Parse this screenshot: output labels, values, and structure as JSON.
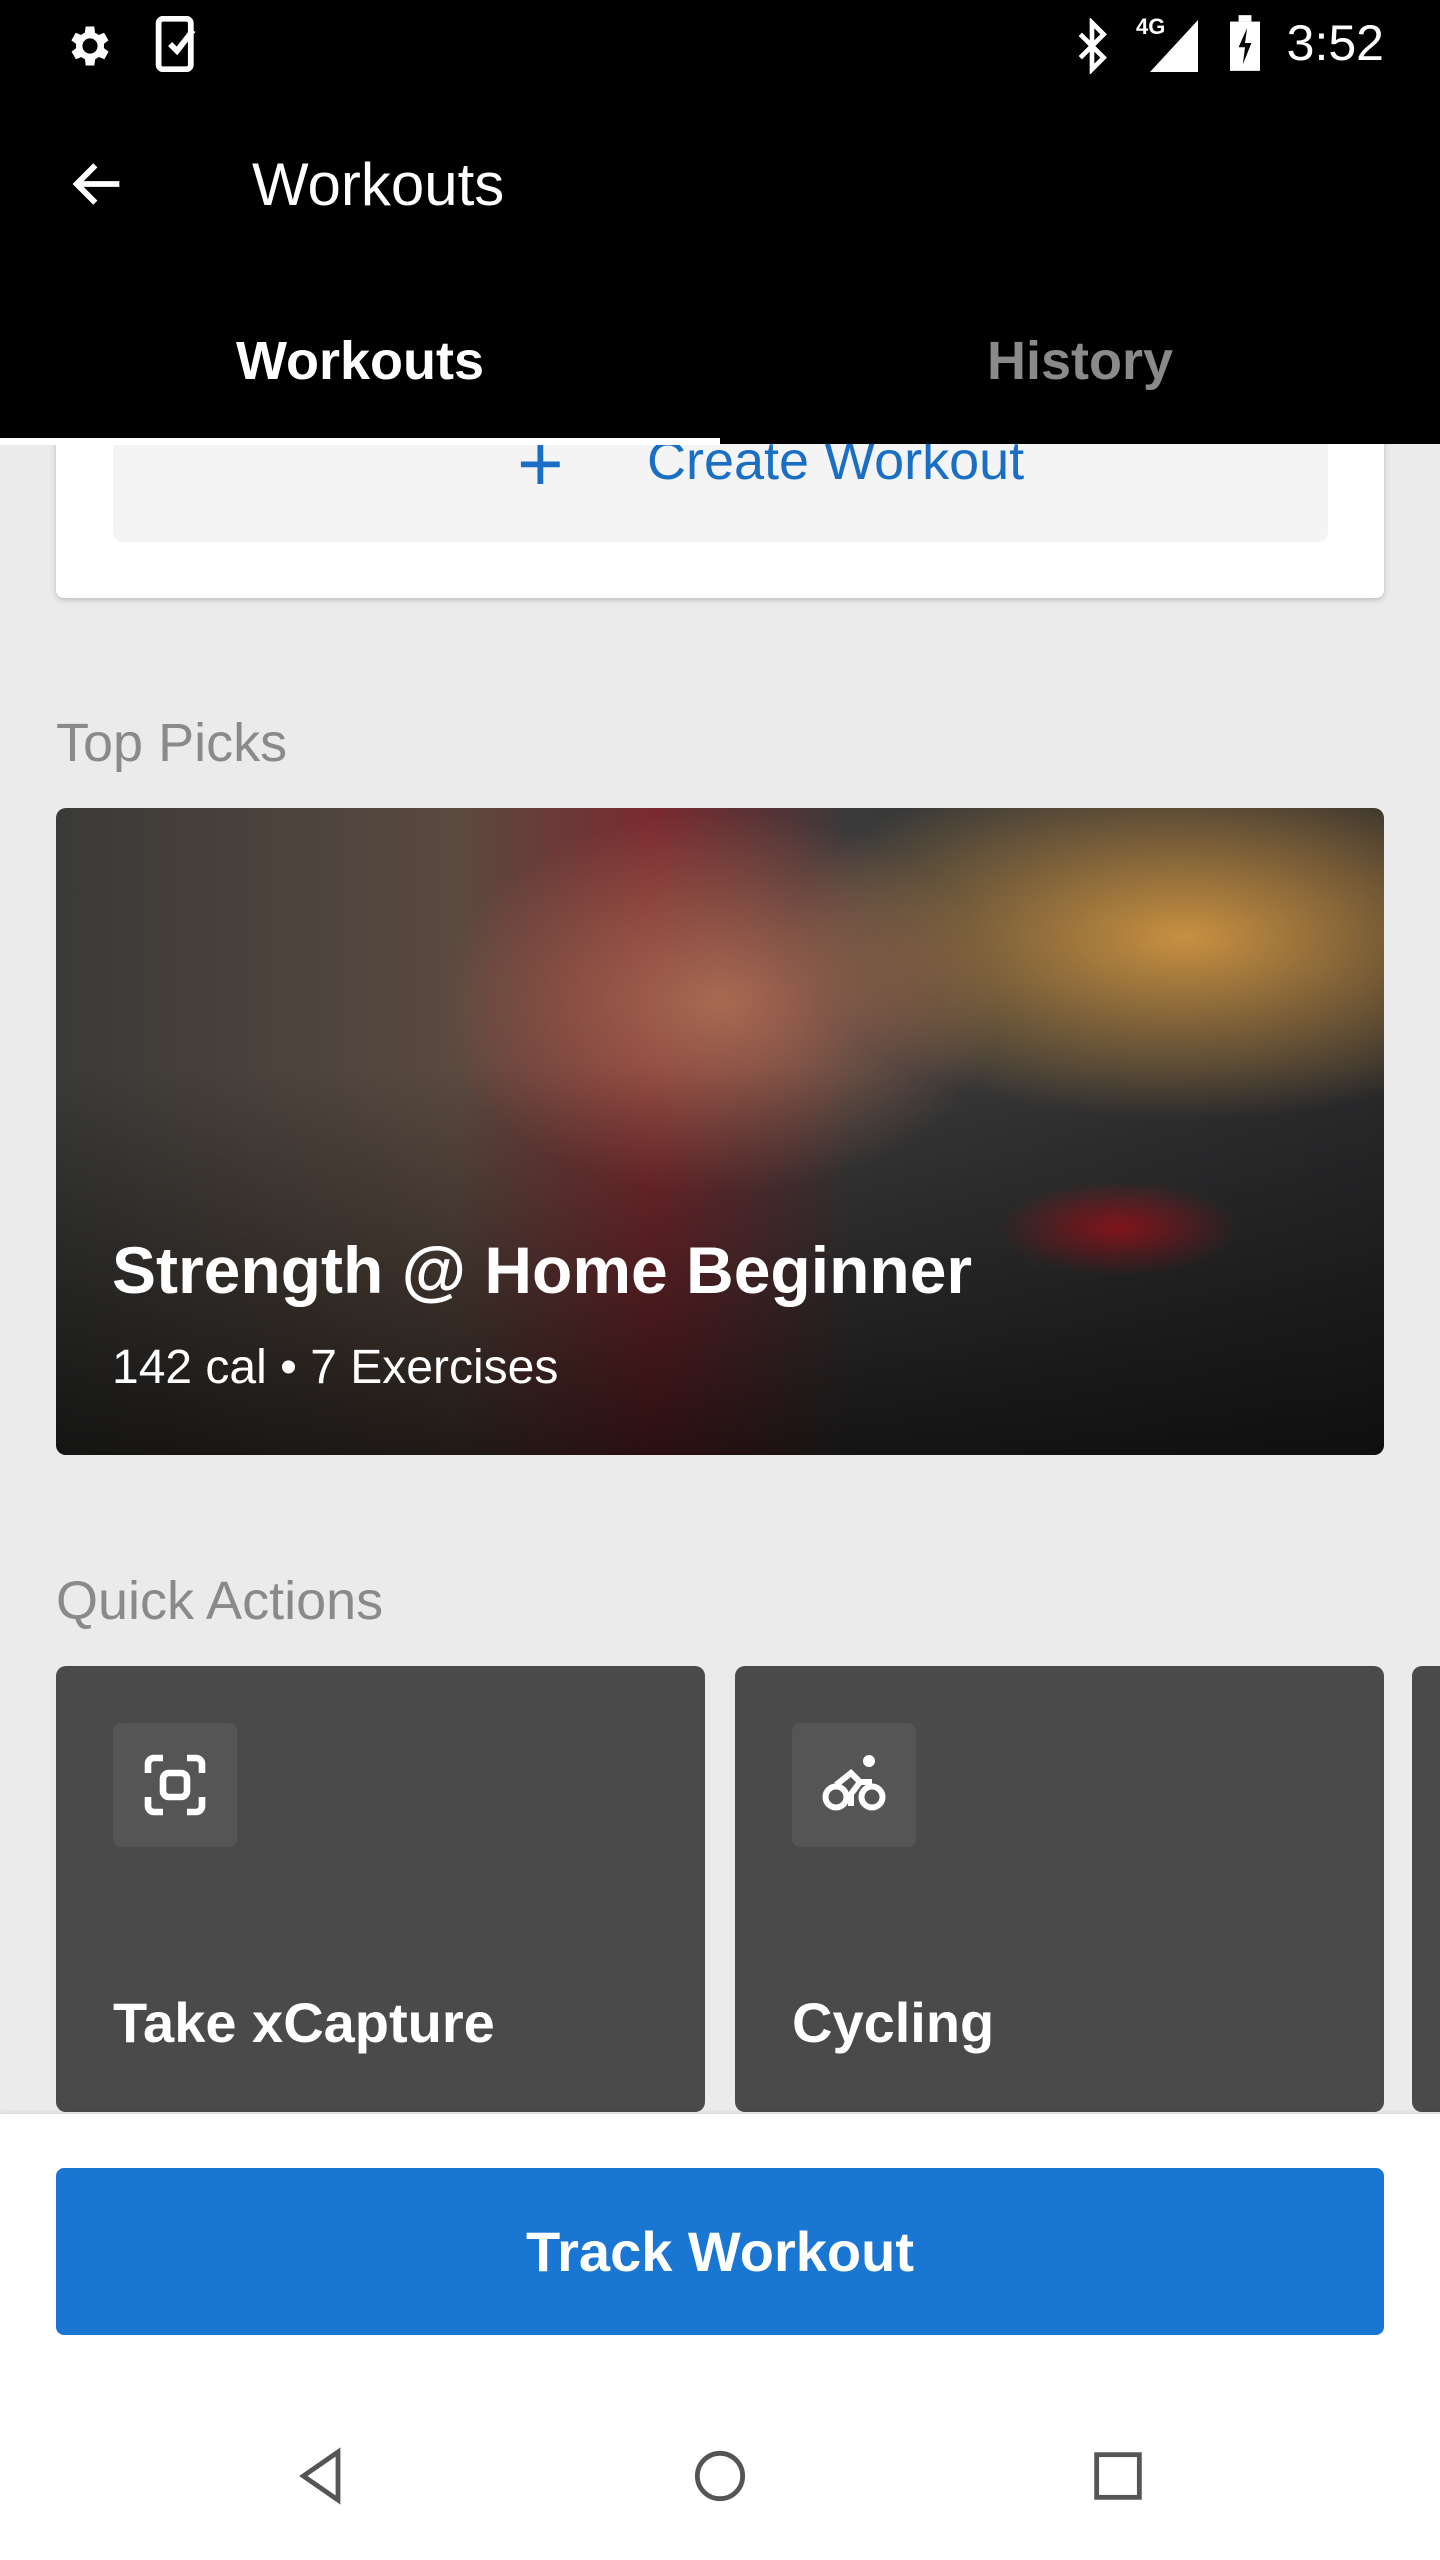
{
  "status_bar": {
    "time": "3:52",
    "network": "4G",
    "icons": [
      "settings-icon",
      "device-check-icon",
      "bluetooth-icon",
      "signal-icon",
      "battery-charging-icon"
    ]
  },
  "app_bar": {
    "title": "Workouts",
    "back_icon": "arrow-left-icon"
  },
  "tabs": [
    {
      "label": "Workouts",
      "selected": true
    },
    {
      "label": "History",
      "selected": false
    }
  ],
  "create": {
    "label": "Create Workout",
    "icon": "plus-icon"
  },
  "top_picks": {
    "heading": "Top Picks",
    "card": {
      "title": "Strength @ Home Beginner",
      "subtitle": "142 cal • 7 Exercises"
    }
  },
  "quick_actions": {
    "heading": "Quick Actions",
    "items": [
      {
        "label": "Take xCapture",
        "icon": "capture-icon"
      },
      {
        "label": "Cycling",
        "icon": "cycling-icon"
      }
    ]
  },
  "track_button": {
    "label": "Track Workout"
  },
  "colors": {
    "accent": "#1976d2",
    "tile": "#4a4a4a",
    "background": "#ebebeb"
  }
}
